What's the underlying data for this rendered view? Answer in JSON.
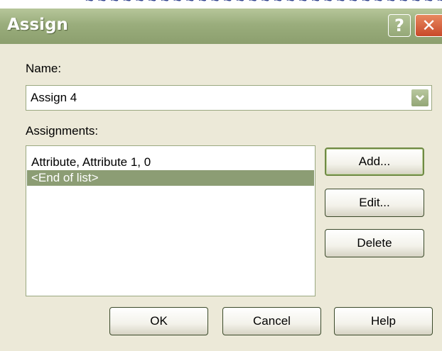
{
  "dialog": {
    "title": "Assign",
    "help_button": "?",
    "close_button": "✕"
  },
  "name_field": {
    "label": "Name:",
    "value": "Assign 4"
  },
  "assignments": {
    "label": "Assignments:",
    "items": [
      {
        "text": "Attribute, Attribute 1, 0",
        "selected": false
      },
      {
        "text": "<End of list>",
        "selected": true
      }
    ]
  },
  "side_buttons": {
    "add": "Add...",
    "edit": "Edit...",
    "delete": "Delete"
  },
  "bottom_buttons": {
    "ok": "OK",
    "cancel": "Cancel",
    "help": "Help"
  },
  "colors": {
    "titlebar": "#9aad7c",
    "selection": "#8c9d74",
    "dialog_bg": "#ece9d8",
    "close": "#c8492a"
  }
}
